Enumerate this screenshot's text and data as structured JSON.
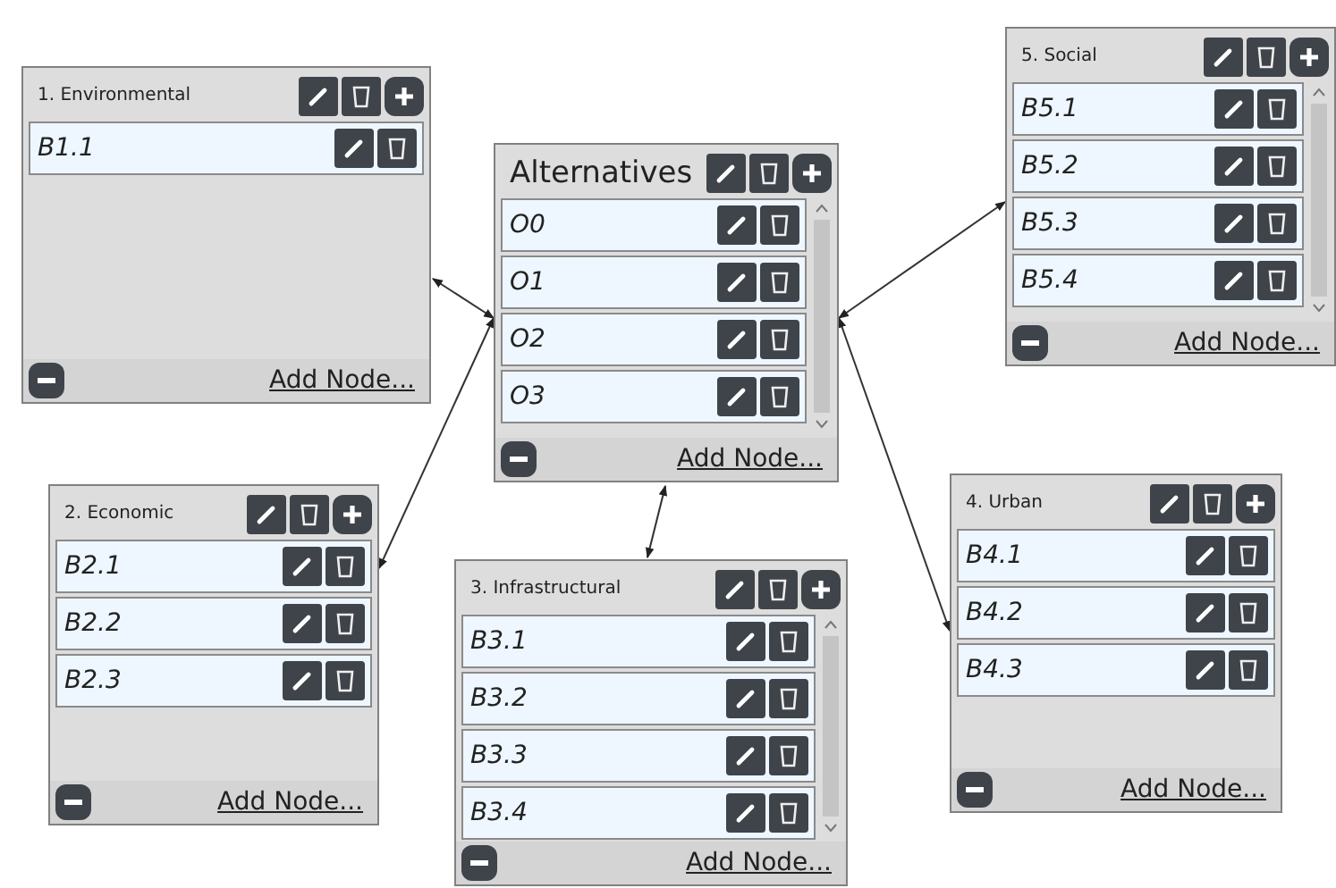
{
  "panels": [
    {
      "title": "1. Environmental",
      "kind": "criterion",
      "scrollbar": false,
      "items": [
        "B1.1"
      ],
      "footer_link": "Add Node..."
    },
    {
      "title": "Alternatives",
      "kind": "main",
      "scrollbar": true,
      "items": [
        "O0",
        "O1",
        "O2",
        "O3"
      ],
      "footer_link": "Add Node..."
    },
    {
      "title": "5. Social",
      "kind": "criterion",
      "scrollbar": true,
      "items": [
        "B5.1",
        "B5.2",
        "B5.3",
        "B5.4"
      ],
      "footer_link": "Add Node..."
    },
    {
      "title": "2. Economic",
      "kind": "criterion",
      "scrollbar": false,
      "items": [
        "B2.1",
        "B2.2",
        "B2.3"
      ],
      "footer_link": "Add Node..."
    },
    {
      "title": "3. Infrastructural",
      "kind": "criterion",
      "scrollbar": true,
      "items": [
        "B3.1",
        "B3.2",
        "B3.3",
        "B3.4"
      ],
      "footer_link": "Add Node..."
    },
    {
      "title": "4. Urban",
      "kind": "criterion",
      "scrollbar": false,
      "items": [
        "B4.1",
        "B4.2",
        "B4.3"
      ],
      "footer_link": "Add Node..."
    }
  ]
}
